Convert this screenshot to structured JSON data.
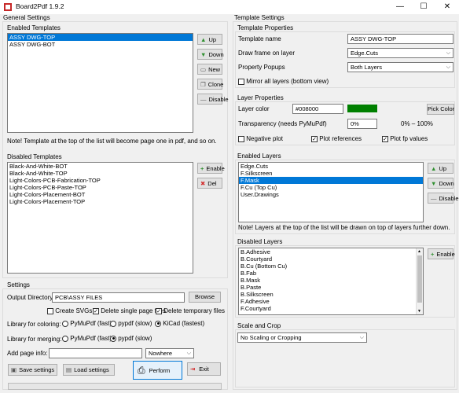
{
  "window": {
    "title": "Board2Pdf 1.9.2",
    "icon": "app-icon",
    "minimize": "—",
    "maximize": "☐",
    "close": "✕"
  },
  "general": {
    "title": "General Settings",
    "enabled": {
      "title": "Enabled Templates",
      "items": [
        "ASSY DWG-TOP",
        "ASSY DWG-BOT"
      ],
      "selected_index": 0,
      "buttons": {
        "up": "Up",
        "down": "Down",
        "new": "New",
        "clone": "Clone",
        "disable": "Disable"
      },
      "note": "Note! Template at the top of the list will become page one in pdf, and so on."
    },
    "disabled": {
      "title": "Disabled Templates",
      "items": [
        "Black-And-White-BOT",
        "Black-And-White-TOP",
        "Light-Colors-PCB-Fabrication-TOP",
        "Light-Colors-PCB-Paste-TOP",
        "Light-Colors-Placement-BOT",
        "Light-Colors-Placement-TOP"
      ],
      "buttons": {
        "enable": "Enable",
        "del": "Del"
      }
    }
  },
  "settings": {
    "title": "Settings",
    "output_label": "Output Directory",
    "output_value": "PCB\\ASSY FILES",
    "browse": "Browse",
    "create_svgs": "Create SVGs",
    "delete_single": "Delete single page files",
    "delete_temp": "Delete temporary files",
    "create_svgs_checked": false,
    "delete_single_checked": true,
    "delete_temp_checked": true,
    "coloring_label": "Library for coloring:",
    "coloring_options": [
      "PyMuPdf (fast)",
      "pypdf (slow)",
      "KiCad (fastest)"
    ],
    "coloring_selected": 2,
    "merging_label": "Library for merging:",
    "merging_options": [
      "PyMuPdf (fast)",
      "pypdf (slow)"
    ],
    "merging_selected": 1,
    "page_info_label": "Add page info:",
    "page_info_value": "",
    "page_info_position": "Nowhere",
    "save": "Save settings",
    "load": "Load settings",
    "perform": "Perform",
    "exit": "Exit",
    "progress": 0
  },
  "template": {
    "title": "Template Settings",
    "props": {
      "title": "Template Properties",
      "name_label": "Template name",
      "name_value": "ASSY DWG-TOP",
      "frame_label": "Draw frame on layer",
      "frame_value": "Edge.Cuts",
      "popups_label": "Property Popups",
      "popups_value": "Both Layers",
      "mirror_label": "Mirror all layers (bottom view)",
      "mirror_checked": false
    },
    "layer_props": {
      "title": "Layer Properties",
      "color_label": "Layer color",
      "color_value": "#008000",
      "color_swatch": "#008000",
      "pick_color": "Pick Color",
      "transparency_label": "Transparency (needs PyMuPdf)",
      "transparency_value": "0%",
      "transparency_range": "0% – 100%",
      "negative_label": "Negative plot",
      "negative_checked": false,
      "plot_refs_label": "Plot references",
      "plot_refs_checked": true,
      "plot_fp_label": "Plot fp values",
      "plot_fp_checked": true
    },
    "enabled_layers": {
      "title": "Enabled Layers",
      "items": [
        "Edge.Cuts",
        "F.Silkscreen",
        "F.Mask",
        "F.Cu (Top Cu)",
        "User.Drawings"
      ],
      "selected_index": 2,
      "buttons": {
        "up": "Up",
        "down": "Down",
        "disable": "Disable"
      },
      "note": "Note! Layers at the top of the list will be drawn on top of layers further down."
    },
    "disabled_layers": {
      "title": "Disabled Layers",
      "items": [
        "B.Adhesive",
        "B.Courtyard",
        "B.Cu (Bottom Cu)",
        "B.Fab",
        "B.Mask",
        "B.Paste",
        "B.Silkscreen",
        "F.Adhesive",
        "F.Courtyard"
      ],
      "enable": "Enable"
    },
    "scale": {
      "title": "Scale and Crop",
      "value": "No Scaling or Cropping"
    }
  }
}
